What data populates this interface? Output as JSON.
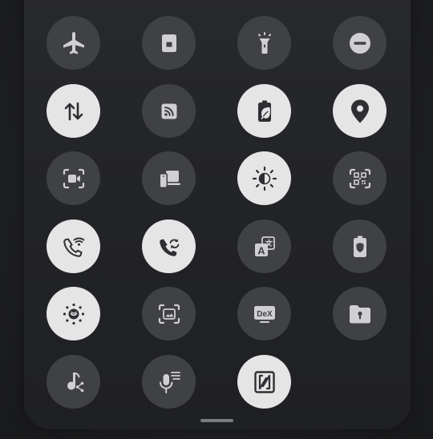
{
  "quick_panel": {
    "colors": {
      "tile_off": "#404145",
      "tile_on": "#e5e5e5",
      "icon_off": "#d0d0d2",
      "icon_on": "#2e2f33"
    },
    "tiles": [
      {
        "icon": "airplane-icon",
        "state": "off"
      },
      {
        "icon": "secure-folder-icon",
        "state": "off"
      },
      {
        "icon": "flashlight-icon",
        "state": "off"
      },
      {
        "icon": "do-not-disturb-icon",
        "state": "off"
      },
      {
        "icon": "mobile-data-icon",
        "state": "on"
      },
      {
        "icon": "cast-icon",
        "state": "off"
      },
      {
        "icon": "power-saving-icon",
        "state": "on"
      },
      {
        "icon": "location-icon",
        "state": "on"
      },
      {
        "icon": "screen-recorder-icon",
        "state": "off"
      },
      {
        "icon": "link-to-windows-icon",
        "state": "off"
      },
      {
        "icon": "dark-mode-icon",
        "state": "on"
      },
      {
        "icon": "qr-scanner-icon",
        "state": "off"
      },
      {
        "icon": "wifi-calling-icon",
        "state": "on"
      },
      {
        "icon": "call-sync-icon",
        "state": "on"
      },
      {
        "icon": "translate-icon",
        "state": "off"
      },
      {
        "icon": "battery-protect-icon",
        "state": "off"
      },
      {
        "icon": "eye-comfort-shield-icon",
        "state": "on"
      },
      {
        "icon": "screenshot-capture-icon",
        "state": "off"
      },
      {
        "icon": "dex-icon",
        "state": "off"
      },
      {
        "icon": "private-share-icon",
        "state": "off"
      },
      {
        "icon": "music-share-icon",
        "state": "off"
      },
      {
        "icon": "live-transcribe-icon",
        "state": "off"
      },
      {
        "icon": "nfc-icon",
        "state": "on"
      }
    ],
    "labels": {
      "dex_text": "DeX",
      "translate_text": "A"
    }
  }
}
